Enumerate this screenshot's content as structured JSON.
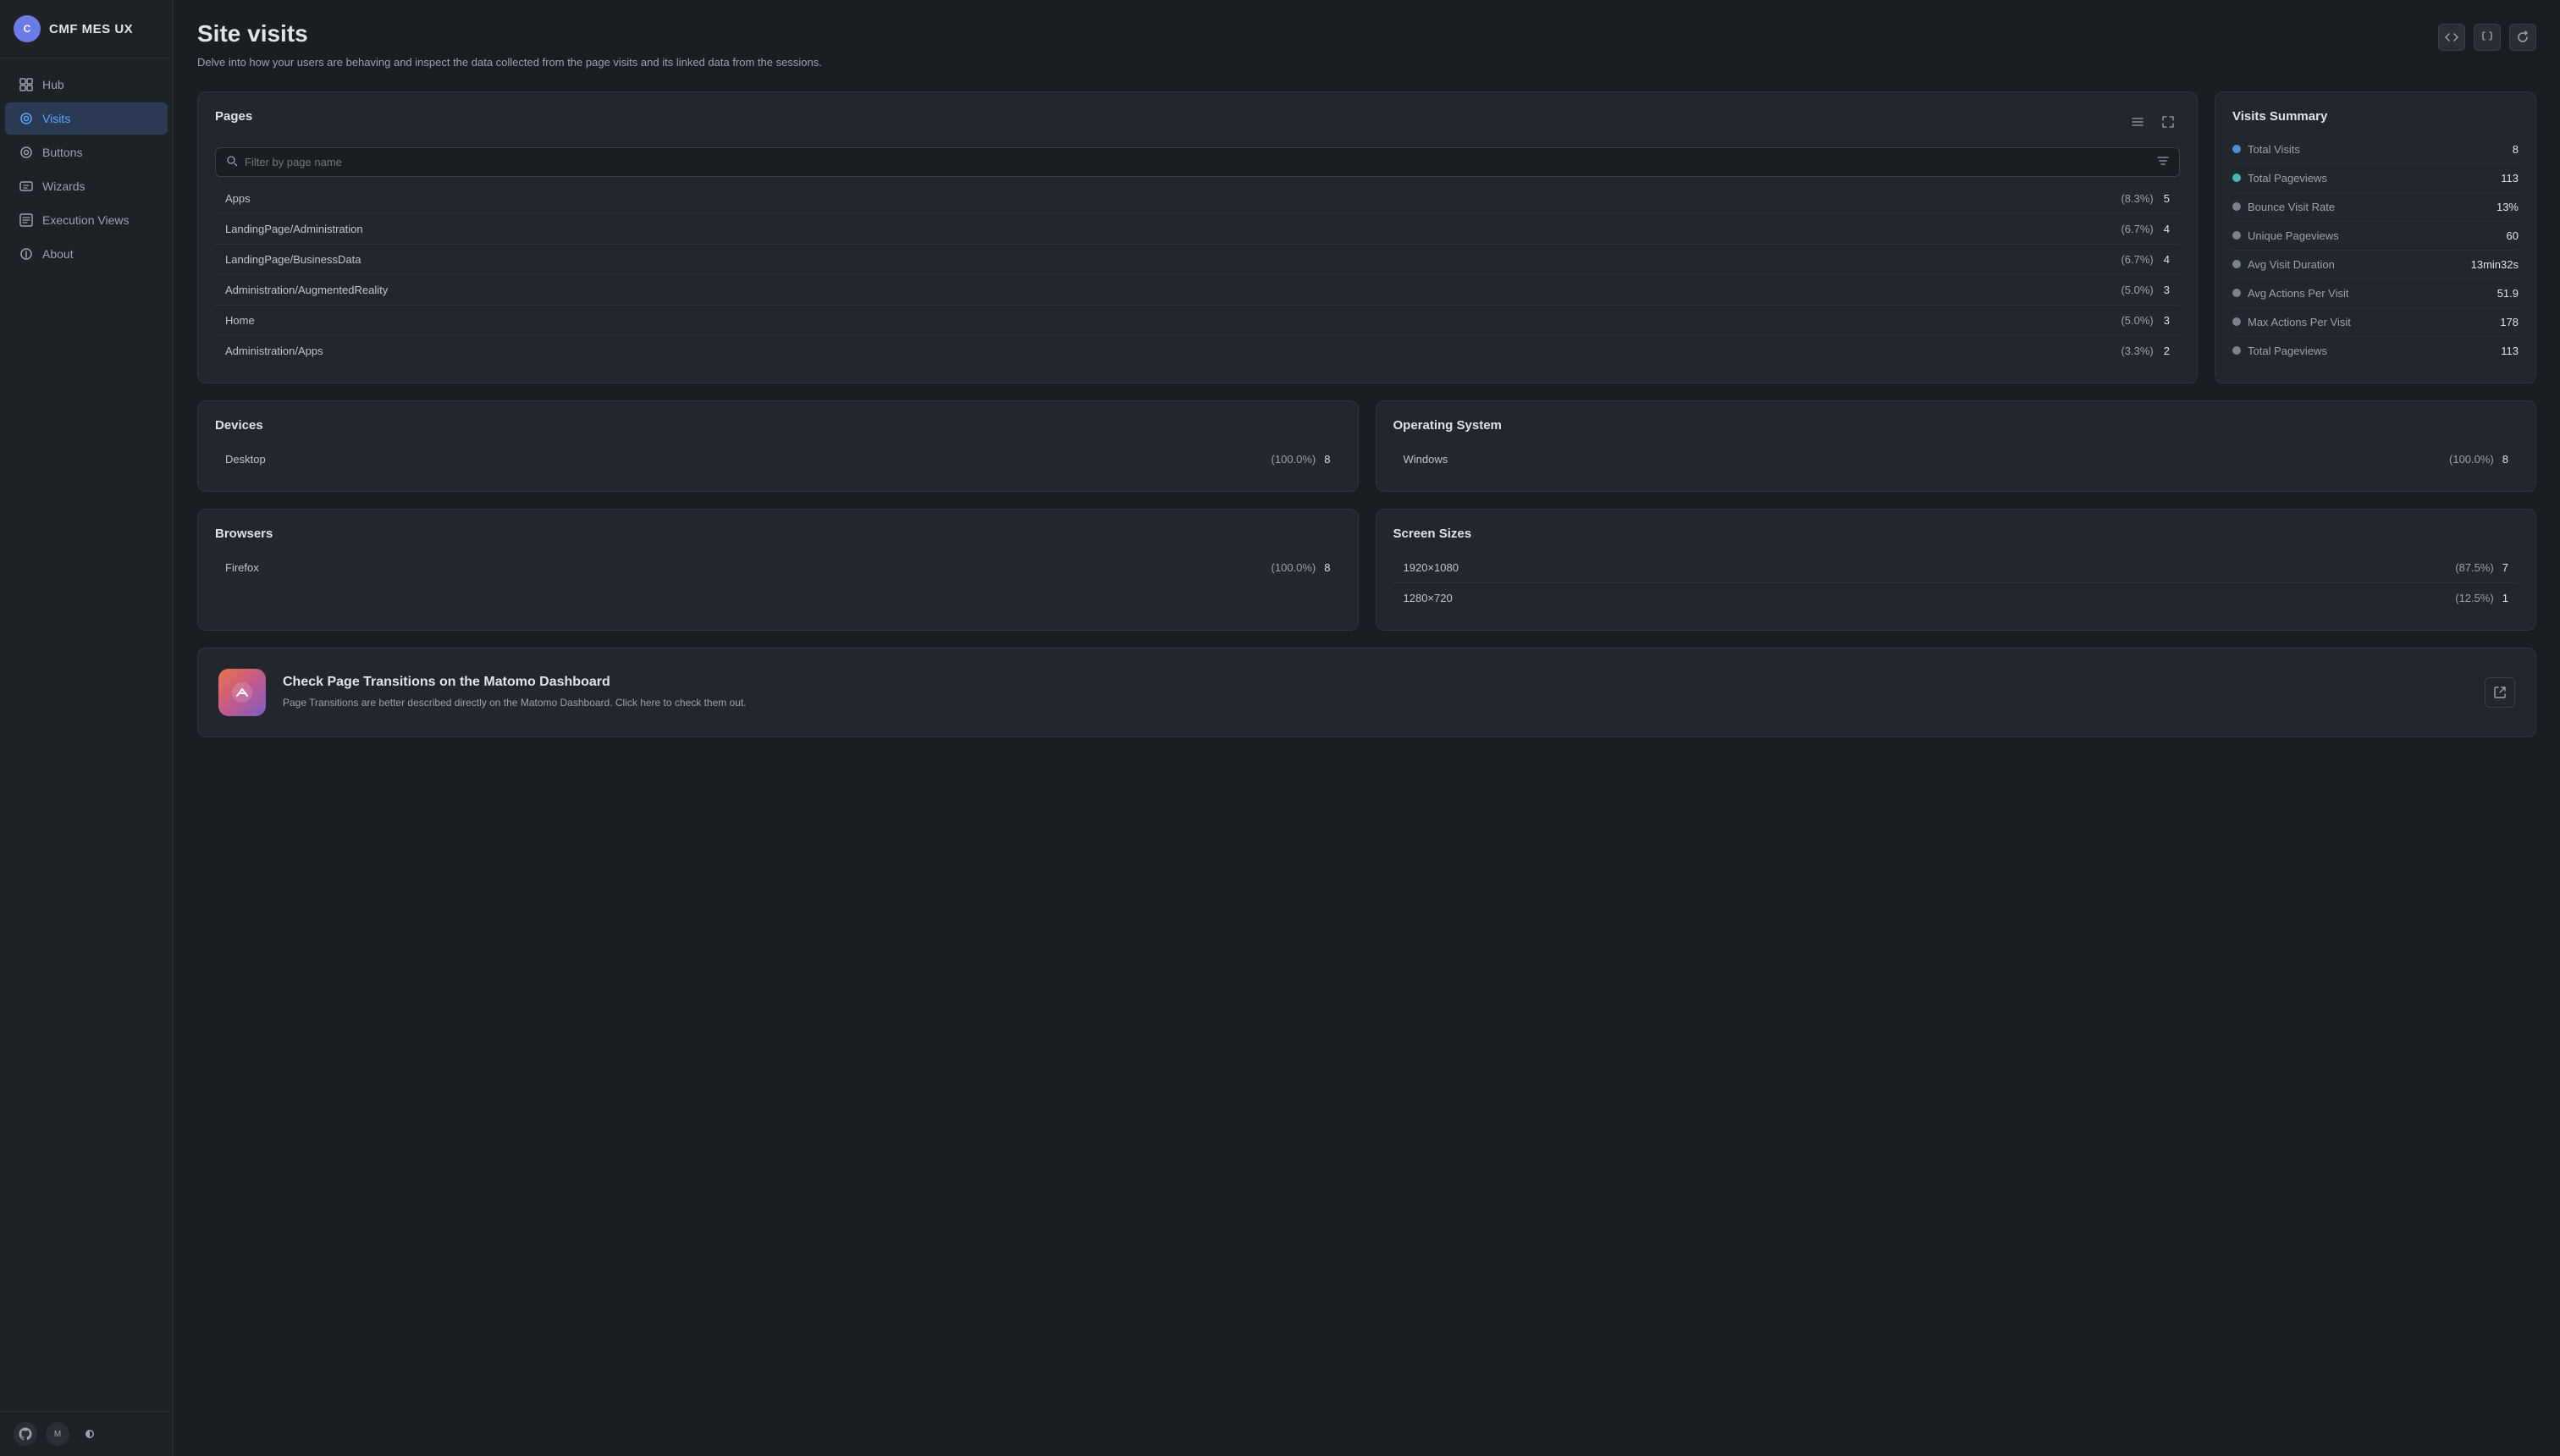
{
  "sidebar": {
    "app_name": "CMF MES UX",
    "avatar_initials": "C",
    "items": [
      {
        "id": "hub",
        "label": "Hub",
        "icon": "⊡",
        "active": false
      },
      {
        "id": "visits",
        "label": "Visits",
        "icon": "◎",
        "active": true
      },
      {
        "id": "buttons",
        "label": "Buttons",
        "icon": "◎",
        "active": false
      },
      {
        "id": "wizards",
        "label": "Wizards",
        "icon": "⊞",
        "active": false
      },
      {
        "id": "execution-views",
        "label": "Execution Views",
        "icon": "⊟",
        "active": false
      },
      {
        "id": "about",
        "label": "About",
        "icon": "ⓘ",
        "active": false
      }
    ]
  },
  "header": {
    "title": "Site visits",
    "subtitle": "Delve into how your users are behaving and inspect the data collected from the page visits and its linked data from the sessions.",
    "actions": {
      "code_icon": "</> ",
      "braces_icon": "{}",
      "refresh_icon": "↻"
    }
  },
  "pages": {
    "title": "Pages",
    "search_placeholder": "Filter by page name",
    "rows": [
      {
        "name": "Apps",
        "percent": "(8.3%)",
        "count": "5"
      },
      {
        "name": "LandingPage/Administration",
        "percent": "(6.7%)",
        "count": "4"
      },
      {
        "name": "LandingPage/BusinessData",
        "percent": "(6.7%)",
        "count": "4"
      },
      {
        "name": "Administration/AugmentedReality",
        "percent": "(5.0%)",
        "count": "3"
      },
      {
        "name": "Home",
        "percent": "(5.0%)",
        "count": "3"
      },
      {
        "name": "Administration/Apps",
        "percent": "(3.3%)",
        "count": "2"
      }
    ]
  },
  "visits_summary": {
    "title": "Visits Summary",
    "items": [
      {
        "label": "Total Visits",
        "value": "8",
        "dot": "dot-blue"
      },
      {
        "label": "Total Pageviews",
        "value": "113",
        "dot": "dot-teal"
      },
      {
        "label": "Bounce Visit Rate",
        "value": "13%",
        "dot": "dot-gray"
      },
      {
        "label": "Unique Pageviews",
        "value": "60",
        "dot": "dot-gray"
      },
      {
        "label": "Avg Visit Duration",
        "value": "13min32s",
        "dot": "dot-gray"
      },
      {
        "label": "Avg Actions Per Visit",
        "value": "51.9",
        "dot": "dot-gray"
      },
      {
        "label": "Max Actions Per Visit",
        "value": "178",
        "dot": "dot-gray"
      },
      {
        "label": "Total Pageviews",
        "value": "113",
        "dot": "dot-gray"
      }
    ]
  },
  "devices": {
    "title": "Devices",
    "rows": [
      {
        "name": "Desktop",
        "percent": "(100.0%)",
        "count": "8"
      }
    ]
  },
  "operating_system": {
    "title": "Operating System",
    "rows": [
      {
        "name": "Windows",
        "percent": "(100.0%)",
        "count": "8"
      }
    ]
  },
  "browsers": {
    "title": "Browsers",
    "rows": [
      {
        "name": "Firefox",
        "percent": "(100.0%)",
        "count": "8"
      }
    ]
  },
  "screen_sizes": {
    "title": "Screen Sizes",
    "rows": [
      {
        "name": "1920×1080",
        "percent": "(87.5%)",
        "count": "7"
      },
      {
        "name": "1280×720",
        "percent": "(12.5%)",
        "count": "1"
      }
    ]
  },
  "cta": {
    "title": "Check Page Transitions on the Matomo Dashboard",
    "subtitle": "Page Transitions are better described directly on the Matomo Dashboard. Click here to check them out.",
    "icon": "🔀"
  }
}
